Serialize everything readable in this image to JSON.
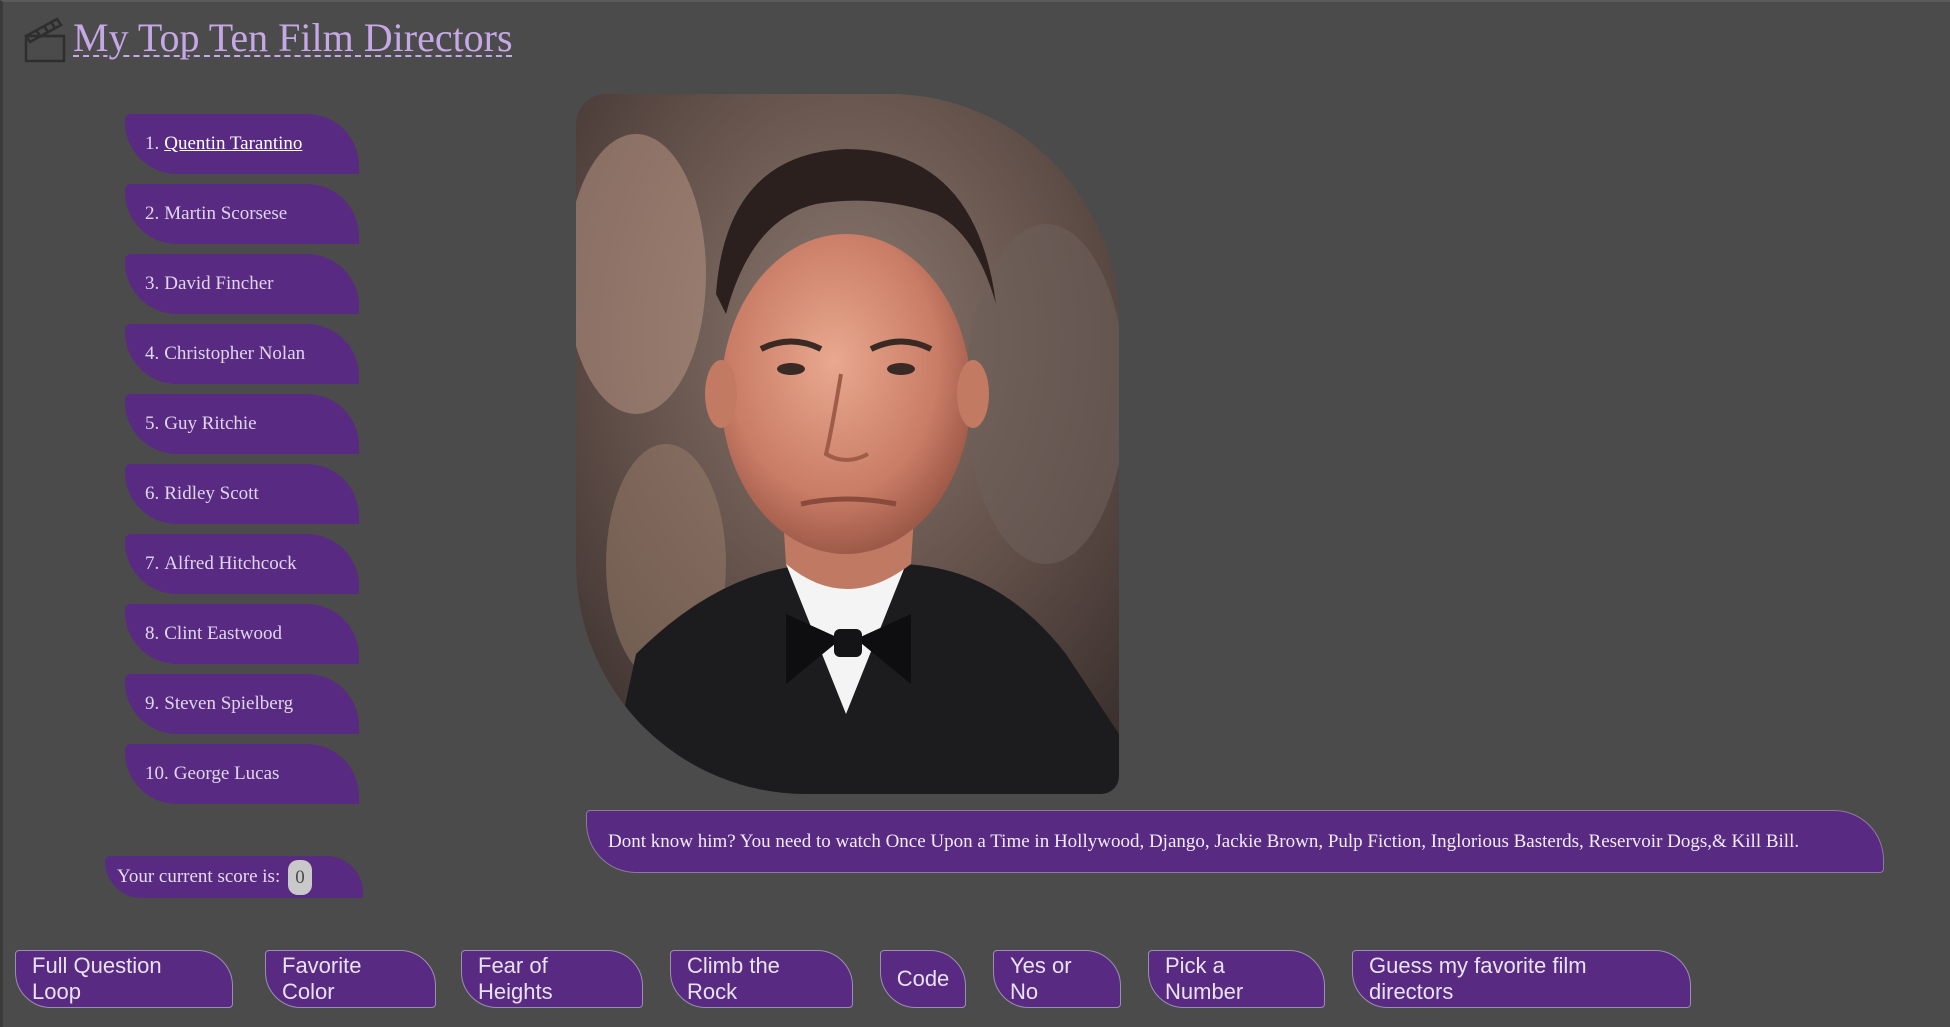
{
  "header": {
    "title": "My Top Ten Film Directors",
    "icon": "clapperboard-icon"
  },
  "directors": [
    {
      "num": "1.",
      "name": "Quentin Tarantino",
      "active": true
    },
    {
      "num": "2.",
      "name": "Martin Scorsese"
    },
    {
      "num": "3.",
      "name": "David Fincher"
    },
    {
      "num": "4.",
      "name": "Christopher Nolan"
    },
    {
      "num": "5.",
      "name": "Guy Ritchie"
    },
    {
      "num": "6.",
      "name": "Ridley Scott"
    },
    {
      "num": "7.",
      "name": "Alfred Hitchcock"
    },
    {
      "num": "8.",
      "name": "Clint Eastwood"
    },
    {
      "num": "9.",
      "name": "Steven Spielberg"
    },
    {
      "num": "10.",
      "name": "George Lucas"
    }
  ],
  "score": {
    "label": "Your current score is:",
    "value": "0"
  },
  "info": {
    "text": "Dont know him? You need to watch Once Upon a Time in Hollywood, Django, Jackie Brown, Pulp Fiction, Inglorious Basterds, Reservoir Dogs,& Kill Bill."
  },
  "buttons": [
    "Full Question Loop",
    "Favorite Color",
    "Fear of Heights",
    "Climb the Rock",
    "Code",
    "Yes or No",
    "Pick a Number",
    "Guess my favorite film directors"
  ],
  "colors": {
    "background": "#4b4b4b",
    "accent": "#582a82",
    "title": "#c6a8e6"
  }
}
